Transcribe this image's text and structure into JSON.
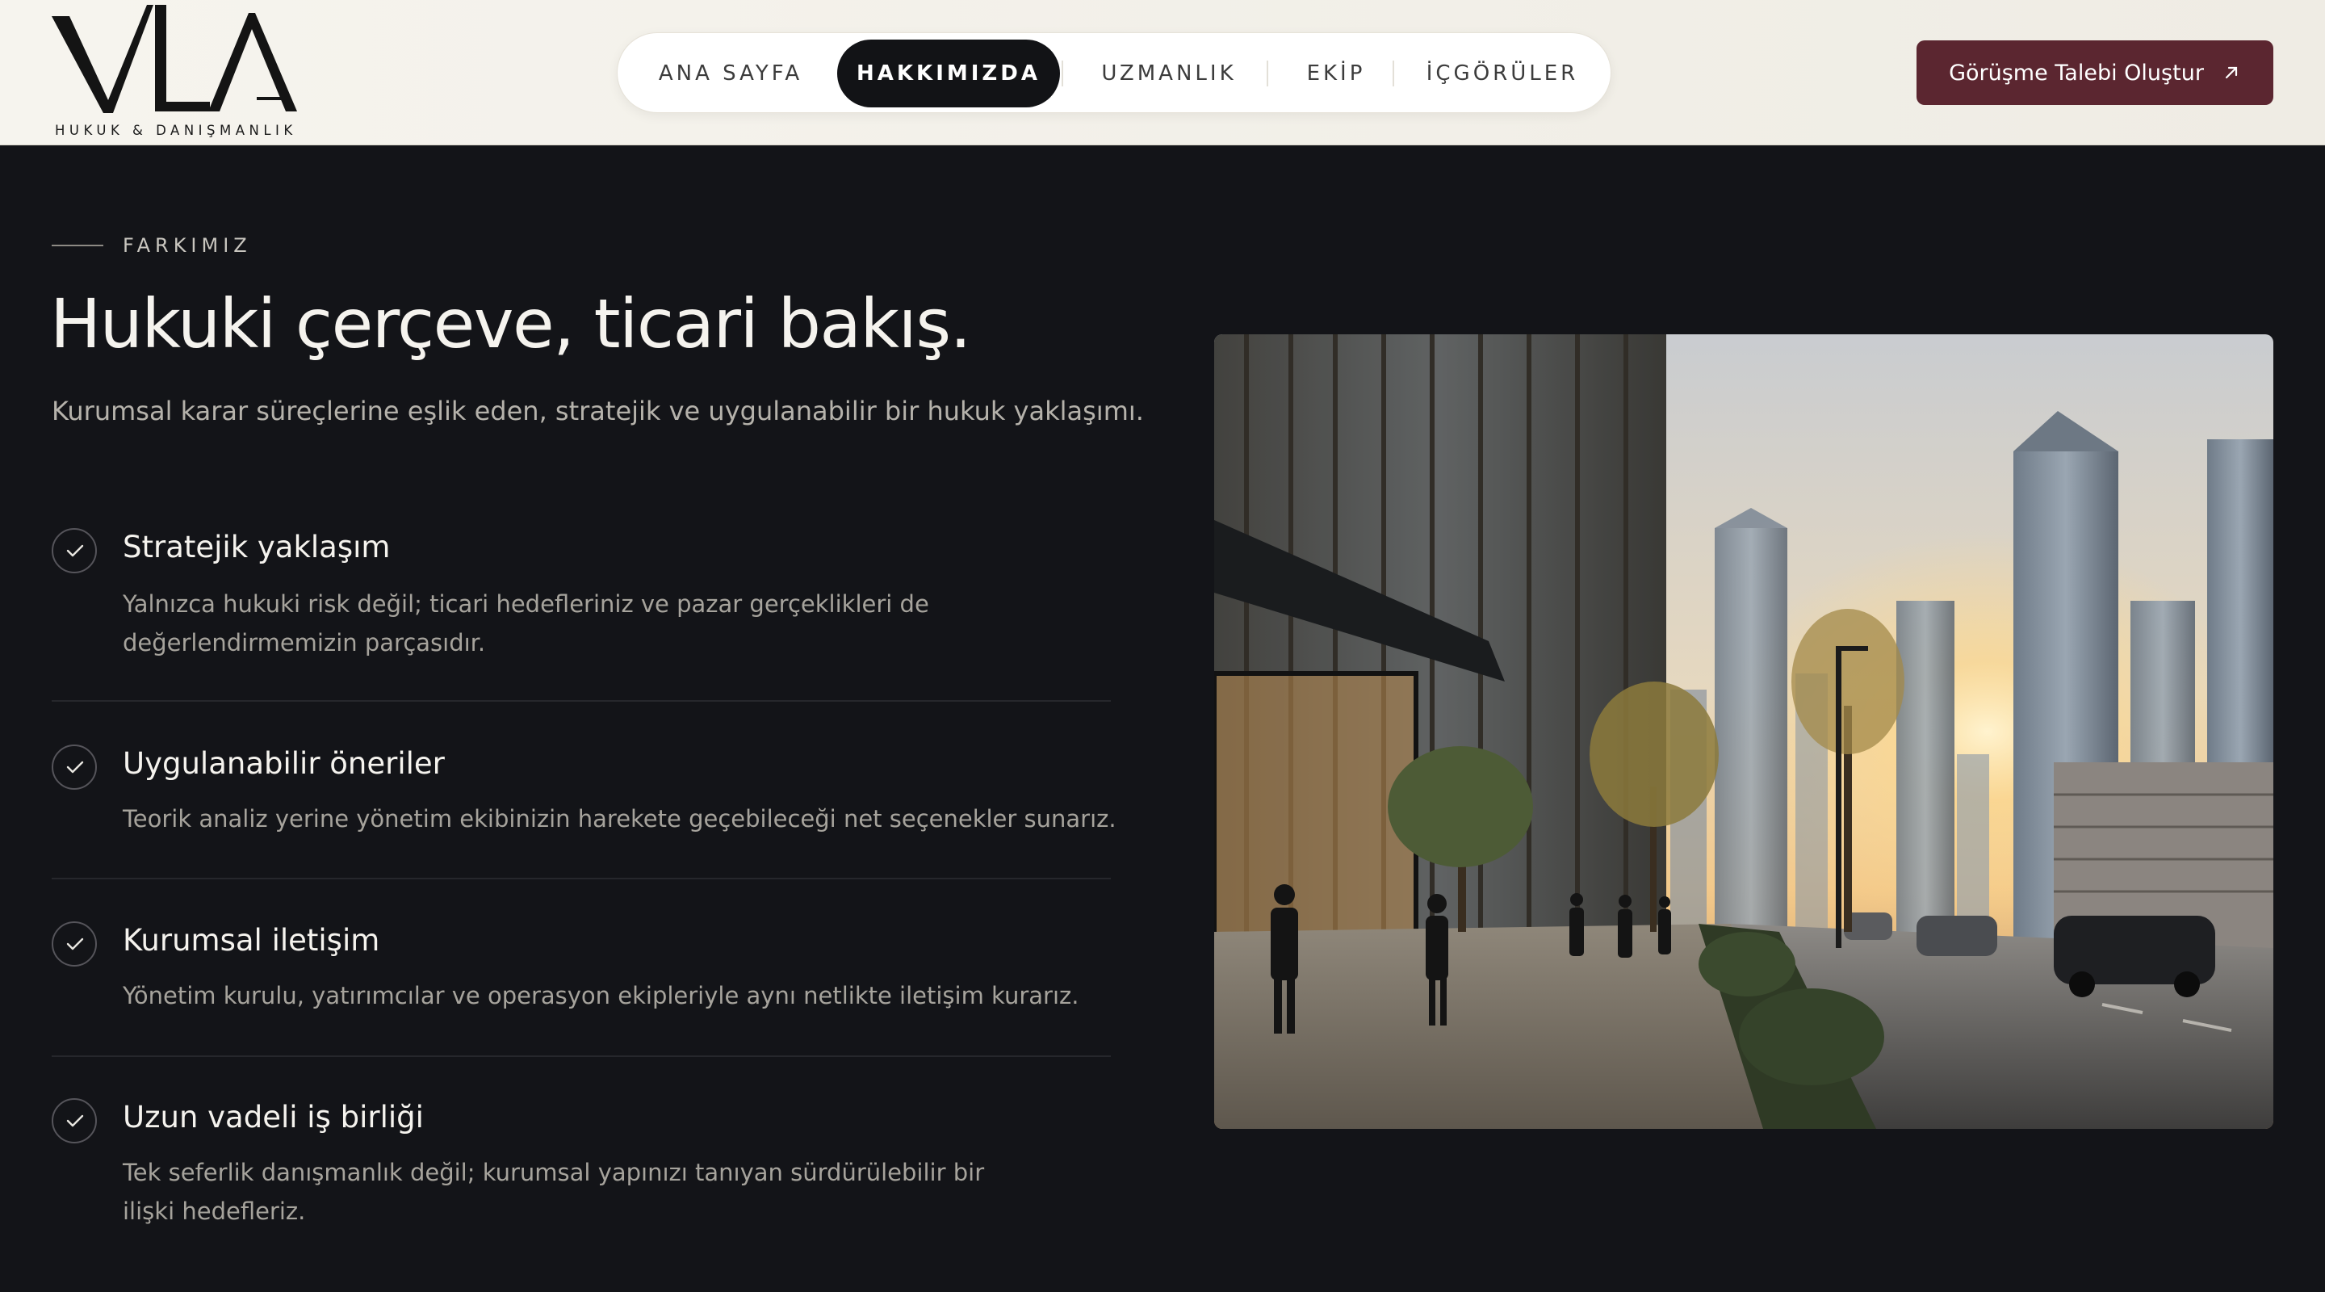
{
  "brand": {
    "logo_text": "VLA",
    "subtitle": "HUKUK & DANIŞMANLIK"
  },
  "nav": {
    "items": [
      {
        "label": "ANA SAYFA",
        "active": false
      },
      {
        "label": "HAKKIMIZDA",
        "active": true
      },
      {
        "label": "UZMANLIK",
        "active": false
      },
      {
        "label": "EKİP",
        "active": false
      },
      {
        "label": "İÇGÖRÜLER",
        "active": false
      }
    ]
  },
  "cta": {
    "label": "Görüşme Talebi Oluştur",
    "icon": "arrow-up-right-icon"
  },
  "section": {
    "eyebrow": "FARKIMIZ",
    "title": "Hukuki çerçeve, ticari bakış.",
    "subtitle": "Kurumsal karar süreçlerine eşlik eden, stratejik ve uygulanabilir bir hukuk yaklaşımı."
  },
  "features": [
    {
      "title": "Stratejik yaklaşım",
      "desc": "Yalnızca hukuki risk değil; ticari hedefleriniz ve pazar gerçeklikleri de değerlendirmemizin parçasıdır.",
      "icon": "check-icon"
    },
    {
      "title": "Uygulanabilir öneriler",
      "desc": "Teorik analiz yerine yönetim ekibinizin harekete geçebileceği net seçenekler sunarız.",
      "icon": "check-icon"
    },
    {
      "title": "Kurumsal iletişim",
      "desc": "Yönetim kurulu, yatırımcılar ve operasyon ekipleriyle aynı netlikte iletişim kurarız.",
      "icon": "check-icon"
    },
    {
      "title": "Uzun vadeli iş birliği",
      "desc": "Tek seferlik danışmanlık değil; kurumsal yapınızı tanıyan sürdürülebilir bir ilişki hedefleriz.",
      "icon": "check-icon"
    }
  ],
  "colors": {
    "accent": "#5b2630",
    "background": "#131418",
    "header_bg": "#f3f1eb"
  }
}
